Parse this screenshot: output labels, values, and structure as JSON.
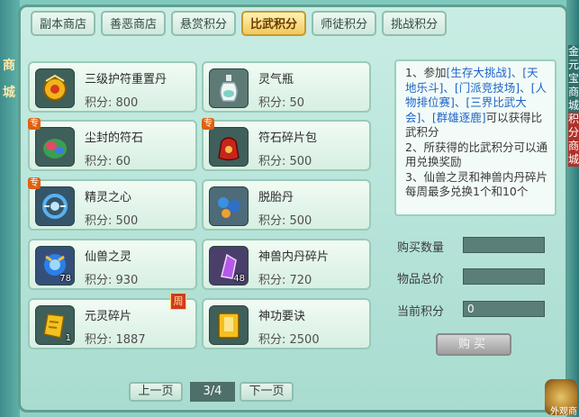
{
  "side": {
    "left_text_1": "商",
    "left_text_2": "城",
    "right_text_1": "金元宝商城",
    "right_text_2": "积分商城",
    "corner_text": "外观商"
  },
  "tabs": [
    {
      "label": "副本商店"
    },
    {
      "label": "善恶商店"
    },
    {
      "label": "悬赏积分"
    },
    {
      "label": "比武积分",
      "active": true
    },
    {
      "label": "师徒积分"
    },
    {
      "label": "挑战积分"
    }
  ],
  "items": [
    {
      "name": "三级护符重置丹",
      "price": "积分: 800",
      "icon": "gold-amulet-icon"
    },
    {
      "name": "灵气瓶",
      "price": "积分: 50",
      "icon": "spirit-bottle-icon"
    },
    {
      "name": "尘封的符石",
      "price": "积分: 60",
      "icon": "rune-stone-icon",
      "badge": "专"
    },
    {
      "name": "符石碎片包",
      "price": "积分: 500",
      "icon": "rune-fragment-bag-icon",
      "badge": "专"
    },
    {
      "name": "精灵之心",
      "price": "积分: 500",
      "icon": "spirit-heart-icon",
      "badge": "专"
    },
    {
      "name": "脱胎丹",
      "price": "积分: 500",
      "icon": "rebirth-pill-icon"
    },
    {
      "name": "仙兽之灵",
      "price": "积分: 930",
      "icon": "immortal-beast-spirit-icon",
      "qty": "78"
    },
    {
      "name": "神兽内丹碎片",
      "price": "积分: 720",
      "icon": "divine-beast-core-fragment-icon",
      "qty": "48"
    },
    {
      "name": "元灵碎片",
      "price": "积分: 1887",
      "icon": "yuanling-fragment-icon",
      "qty": "1",
      "weekly": "周"
    },
    {
      "name": "神功要诀",
      "price": "积分: 2500",
      "icon": "skill-manual-icon"
    }
  ],
  "info": {
    "l1a": "1、参加",
    "l1b": "[生存大挑战]、[天地乐斗]、[门派竞技场]、[人物排位赛]、[三界比武大会]、[群雄逐鹿]",
    "l1c": "可以获得比武积分",
    "l2": "2、所获得的比武积分可以通用兑换奖励",
    "l3": "3、仙兽之灵和神兽内丹碎片每周最多兑换1个和10个"
  },
  "form": {
    "qty_label": "购买数量",
    "qty_value": "",
    "total_label": "物品总价",
    "total_value": "",
    "points_label": "当前积分",
    "points_value": "0",
    "buy_label": "购买"
  },
  "pager": {
    "prev": "上一页",
    "page": "3/4",
    "next": "下一页"
  }
}
